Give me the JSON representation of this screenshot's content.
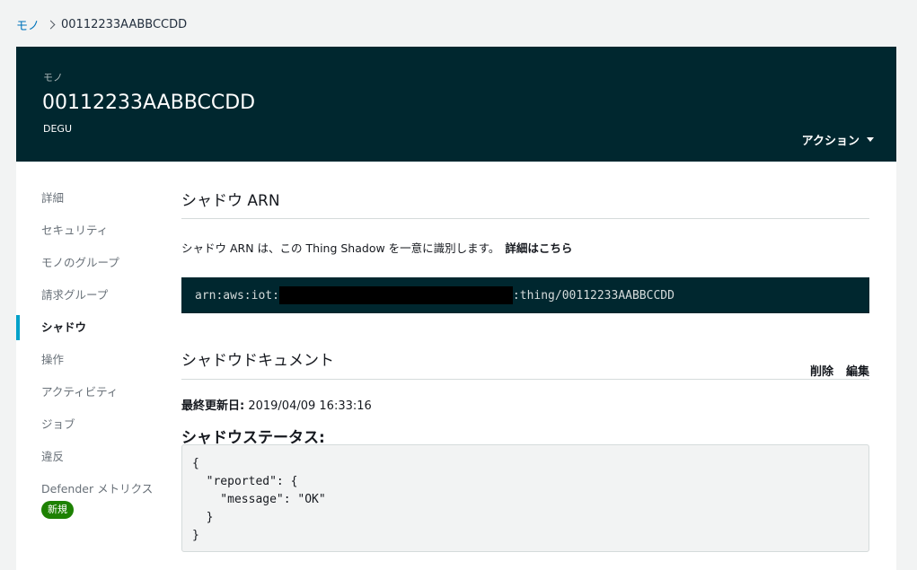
{
  "breadcrumb": {
    "parent": "モノ",
    "current": "00112233AABBCCDD"
  },
  "header": {
    "label": "モノ",
    "title": "00112233AABBCCDD",
    "subtitle": "DEGU",
    "actions_label": "アクション"
  },
  "sidenav": {
    "items": [
      {
        "label": "詳細"
      },
      {
        "label": "セキュリティ"
      },
      {
        "label": "モノのグループ"
      },
      {
        "label": "請求グループ"
      },
      {
        "label": "シャドウ",
        "active": true
      },
      {
        "label": "操作"
      },
      {
        "label": "アクティビティ"
      },
      {
        "label": "ジョブ"
      },
      {
        "label": "違反"
      },
      {
        "label": "Defender メトリクス"
      }
    ],
    "badge": "新規"
  },
  "shadow_arn": {
    "title": "シャドウ ARN",
    "description": "シャドウ ARN は、この Thing Shadow を一意に識別します。",
    "learn_more": "詳細はこちら",
    "arn_prefix": "arn:aws:iot:",
    "arn_suffix": ":thing/00112233AABBCCDD"
  },
  "shadow_document": {
    "title": "シャドウドキュメント",
    "delete_label": "削除",
    "edit_label": "編集",
    "last_updated_key": "最終更新日:",
    "last_updated_value": "2019/04/09 16:33:16",
    "status_title": "シャドウステータス:",
    "json": "{\n  \"reported\": {\n    \"message\": \"OK\"\n  }\n}"
  },
  "colors": {
    "header_bg": "#00272f",
    "accent": "#00a1c9",
    "link": "#0073bb",
    "badge": "#1d8102"
  }
}
